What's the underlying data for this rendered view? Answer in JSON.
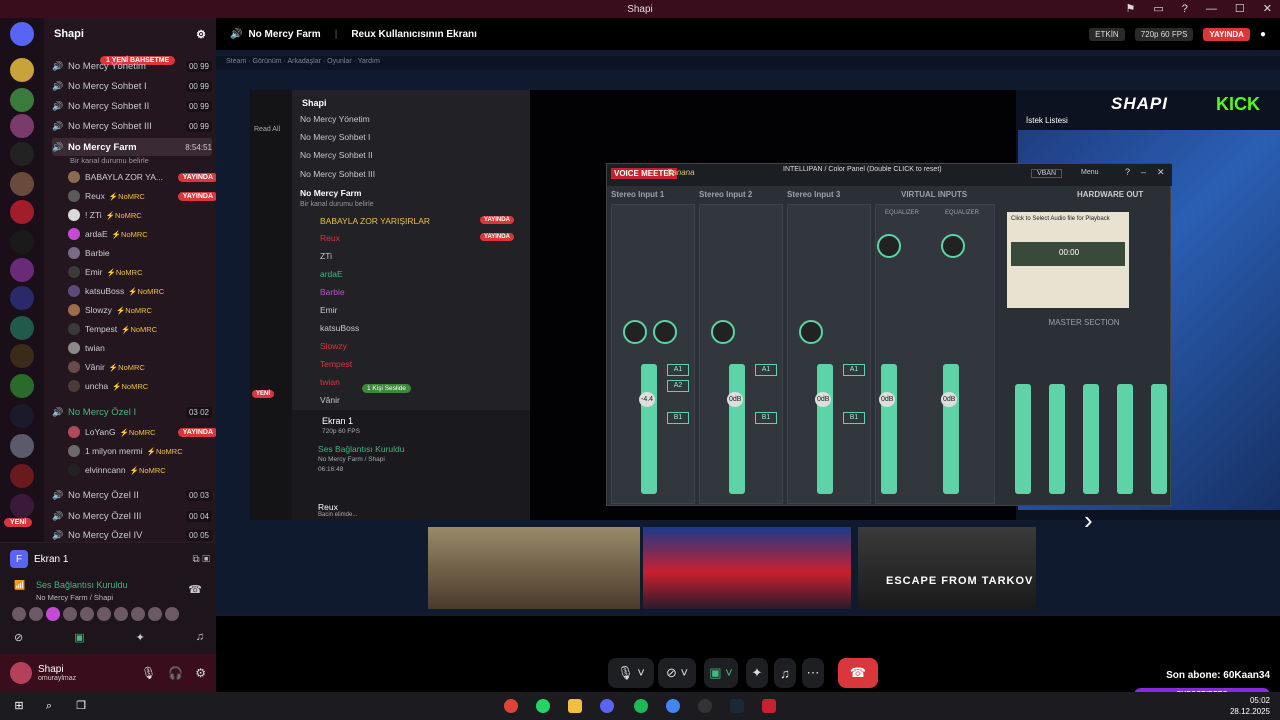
{
  "window": {
    "title": "Shapi",
    "controls": [
      "⚑",
      "▭",
      "?",
      "—",
      "☐",
      "✕"
    ]
  },
  "server": {
    "name": "Shapi",
    "new_messages_pill": "1 YENİ BAHSETME",
    "new_pill": "YENİ"
  },
  "channels": [
    {
      "name": "No Mercy Yönetim",
      "count_a": "00",
      "count_b": "99"
    },
    {
      "name": "No Mercy Sohbet I",
      "count_a": "00",
      "count_b": "99"
    },
    {
      "name": "No Mercy Sohbet II",
      "count_a": "00",
      "count_b": "99"
    },
    {
      "name": "No Mercy Sohbet III",
      "count_a": "00",
      "count_b": "99"
    }
  ],
  "active_channel": {
    "name": "No Mercy Farm",
    "time": "8:54:51",
    "status": "Bir kanal durumu belirle"
  },
  "users_farm": [
    {
      "name": "BABAYLA ZOR YA...",
      "tag": "",
      "live": "YAYINDA",
      "color": "#8a6b4f"
    },
    {
      "name": "Reux",
      "tag": "⚡NoMRC",
      "live": "YAYINDA",
      "color": "#5a5a5a"
    },
    {
      "name": "! ZTi",
      "tag": "⚡NoMRC",
      "live": "",
      "color": "#d9d9d9"
    },
    {
      "name": "ardaE",
      "tag": "⚡NoMRC",
      "live": "",
      "color": "#c54bd6"
    },
    {
      "name": "Barbie",
      "tag": "",
      "live": "",
      "color": "#7b6a88"
    },
    {
      "name": "Emir",
      "tag": "⚡NoMRC",
      "live": "",
      "color": "#3b3b3b"
    },
    {
      "name": "katsuBoss",
      "tag": "⚡NoMRC",
      "live": "",
      "color": "#5b4a7a"
    },
    {
      "name": "Slowzy",
      "tag": "⚡NoMRC",
      "live": "",
      "color": "#a06a4c"
    },
    {
      "name": "Tempest",
      "tag": "⚡NoMRC",
      "live": "",
      "color": "#3a3a3a"
    },
    {
      "name": "twian",
      "tag": "",
      "live": "",
      "color": "#8a8a8a"
    },
    {
      "name": "Vânir",
      "tag": "⚡NoMRC",
      "live": "",
      "color": "#6a4a4a"
    },
    {
      "name": "uncha",
      "tag": "⚡NoMRC",
      "live": "",
      "color": "#4a3a3a"
    }
  ],
  "ozel_channel": {
    "name": "No Mercy Özel I",
    "count_a": "03",
    "count_b": "02"
  },
  "users_ozel": [
    {
      "name": "LoYanG",
      "tag": "⚡NoMRC",
      "live": "YAYINDA",
      "color": "#b04a5a"
    },
    {
      "name": "1 milyon mermi",
      "tag": "⚡NoMRC",
      "live": "",
      "color": "#6a6a6a"
    },
    {
      "name": "elvinncann",
      "tag": "⚡NoMRC",
      "live": "",
      "color": "#222"
    }
  ],
  "more_channels": [
    {
      "name": "No Mercy Özel II",
      "count_a": "00",
      "count_b": "03"
    },
    {
      "name": "No Mercy Özel III",
      "count_a": "00",
      "count_b": "04"
    },
    {
      "name": "No Mercy Özel IV",
      "count_a": "00",
      "count_b": "05"
    }
  ],
  "voice_panel": {
    "screen_title": "Ekran 1",
    "connected": "Ses Bağlantısı Kuruldu",
    "location": "No Mercy Farm / Shapi"
  },
  "user_panel": {
    "name": "Shapi",
    "status": "omuraylmaz"
  },
  "stream_header": {
    "channel": "No Mercy Farm",
    "viewer": "Reux Kullanıcısının Ekranı",
    "activity": "ETKİN",
    "quality": "720p 60 FPS",
    "live": "YAYINDA"
  },
  "inner_discord": {
    "server": "Shapi",
    "read_all": "Read All",
    "channels": [
      "No Mercy Yönetim",
      "No Mercy Sohbet I",
      "No Mercy Sohbet II",
      "No Mercy Sohbet III",
      "No Mercy Farm"
    ],
    "status": "Bir kanal durumu belirle",
    "users": [
      "BABAYLA ZOR YARIŞIRLAR",
      "Reux",
      "ZTi",
      "ardaE",
      "Barbie",
      "Emir",
      "katsuBoss",
      "Slowzy",
      "Tempest",
      "twian",
      "Vânir"
    ],
    "speaking": "1 Kişi Seslide",
    "screen": "Ekran 1",
    "screen_sub": "720p 60 FPS",
    "connected": "Ses Bağlantısı Kuruldu",
    "location": "No Mercy Farm / Shapi",
    "timer": "06:16:48",
    "user": "Reux",
    "user_status": "Bacin elimde...",
    "live": "YAYINDA",
    "new": "YENİ"
  },
  "brand": {
    "shapi": "SHAPI",
    "kick": "KICK",
    "wishlist": "İstek Listesi"
  },
  "voicemeeter": {
    "name": "VOICE MEETER",
    "edition": "Banana",
    "intellipan": "INTELLIPAN / Color Panel (Double CLICK to reset)",
    "strips": [
      "Stereo Input 1",
      "Stereo Input 2",
      "Stereo Input 3"
    ],
    "virtual": "VIRTUAL INPUTS",
    "hardware_out": "HARDWARE OUT",
    "master": "MASTER SECTION",
    "menu": "Menu",
    "vban": "VBAN",
    "eq_label": "EQUALIZER",
    "fader_values": [
      "-4.4",
      "0dB",
      "0dB",
      "0dB",
      "0dB"
    ],
    "recorder": "Click to Select Audio file for Playback",
    "rec_time": "00:00"
  },
  "games": [
    "ESCAPE FROM TARKOV"
  ],
  "overlay": {
    "subscriber": "Son abone: 60Kaan34",
    "bar": "SUBSCRIBERS"
  },
  "clock": {
    "time": "05:02",
    "date": "28.12.2025"
  },
  "colors": {
    "accent": "#da373c",
    "brand": "#3a0d1d",
    "voicemeeter_green": "#5fd3a8",
    "kick": "#53fc18"
  }
}
